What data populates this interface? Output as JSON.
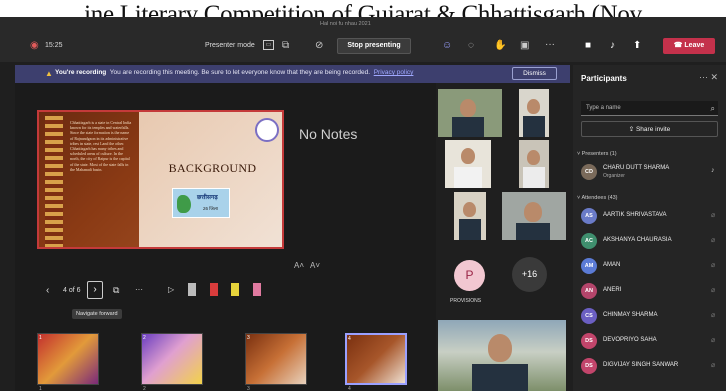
{
  "caption": "ine Literary Competition of Gujarat & Chhattisgarh (Nov",
  "topbar": {
    "window_title": "Hal noi fu nhau 2021",
    "timer": "15:25",
    "presenter_mode_label": "Presenter mode",
    "stop_presenting_label": "Stop presenting",
    "leave_label": "Leave"
  },
  "recording": {
    "title": "You're recording",
    "message": "You are recording this meeting. Be sure to let everyone know that they are being recorded.",
    "privacy_link": "Privacy policy",
    "dismiss_label": "Dismiss"
  },
  "slide": {
    "title": "BACKGROUND",
    "body_text": "Chhattisgarh is a state in Central India known for its temples and waterfalls. Since the state formation is the name of Rajnandgaon in its administrative tribes in state, rest Land the other. Chhattisgarh has many tribes and scheduled areas of culture. In the north, the city of Raipur is the capital of the state. Most of the state falls in the Mahanadi basin.",
    "mini_label": "छत्तीसगढ़",
    "mini_sub": "26 जिला"
  },
  "notes": "No Notes",
  "slide_nav": {
    "counter": "4 of 6",
    "tooltip": "Navigate forward"
  },
  "thumbnails": [
    {
      "n": "1"
    },
    {
      "n": "2"
    },
    {
      "n": "3"
    },
    {
      "n": "4"
    }
  ],
  "gallery": {
    "avatar_initial": "P",
    "overflow_count": "+16",
    "participant_name": "PROVISIONS"
  },
  "panel": {
    "title": "Participants",
    "search_placeholder": "Type a name",
    "share_invite_label": "Share invite",
    "presenters_label": "Presenters (1)",
    "attendees_label": "Attendees (43)",
    "presenter": {
      "initials": "CD",
      "name": "CHARU DUTT SHARMA",
      "role": "Organizer"
    },
    "attendees": [
      {
        "initials": "AS",
        "name": "AARTIK SHRIVASTAVA",
        "color": "#6a7bc8"
      },
      {
        "initials": "AC",
        "name": "AKSHANYA CHAURASIA",
        "color": "#3f8f6e"
      },
      {
        "initials": "AM",
        "name": "AMAN",
        "color": "#5b7bd5"
      },
      {
        "initials": "AN",
        "name": "ANERI",
        "color": "#b4456b"
      },
      {
        "initials": "CS",
        "name": "CHINMAY SHARMA",
        "color": "#6b5fc2"
      },
      {
        "initials": "DS",
        "name": "DEVOPRIYO SAHA",
        "color": "#c2456b"
      },
      {
        "initials": "DS",
        "name": "DIGVIJAY SINGH SANWAR",
        "color": "#c2456b"
      }
    ]
  }
}
